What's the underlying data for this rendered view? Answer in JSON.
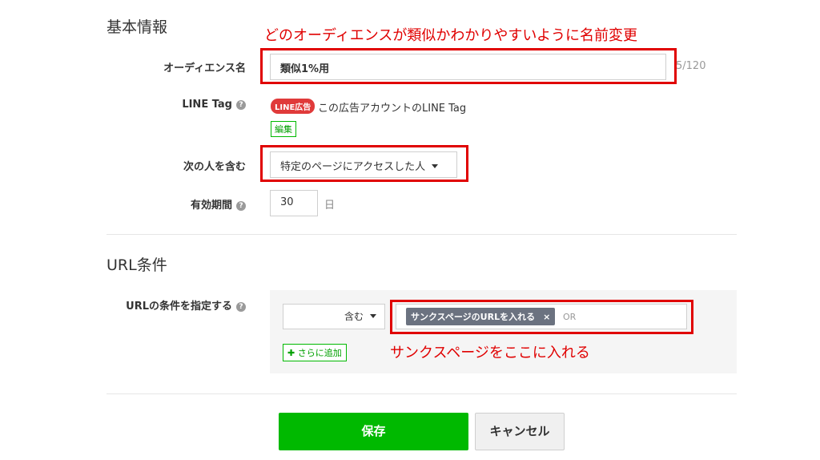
{
  "basic_info": {
    "title": "基本情報",
    "annotation": "どのオーディエンスが類似かわかりやすいように名前変更",
    "audience_name": {
      "label": "オーディエンス名",
      "value": "類似1%用",
      "counter": "5/120"
    },
    "line_tag": {
      "label": "LINE Tag",
      "badge": "LINE広告",
      "text": "この広告アカウントのLINE Tag",
      "edit_label": "編集"
    },
    "include_people": {
      "label": "次の人を含む",
      "selected": "特定のページにアクセスした人"
    },
    "validity": {
      "label": "有効期間",
      "value": "30",
      "unit": "日"
    }
  },
  "url_conditions": {
    "title": "URL条件",
    "specify": {
      "label": "URLの条件を指定する",
      "operator": "含む",
      "tag": "サンクスページのURLを入れる",
      "tag_remove": "×",
      "or": "OR",
      "add_label": "さらに追加",
      "add_icon": "✚"
    },
    "annotation": "サンクスページをここに入れる"
  },
  "actions": {
    "save_label": "保存",
    "cancel_label": "キャンセル"
  },
  "colors": {
    "annotation": "#e00000",
    "save": "#00b900",
    "badge": "#e03a3a",
    "tag": "#6b7280"
  }
}
